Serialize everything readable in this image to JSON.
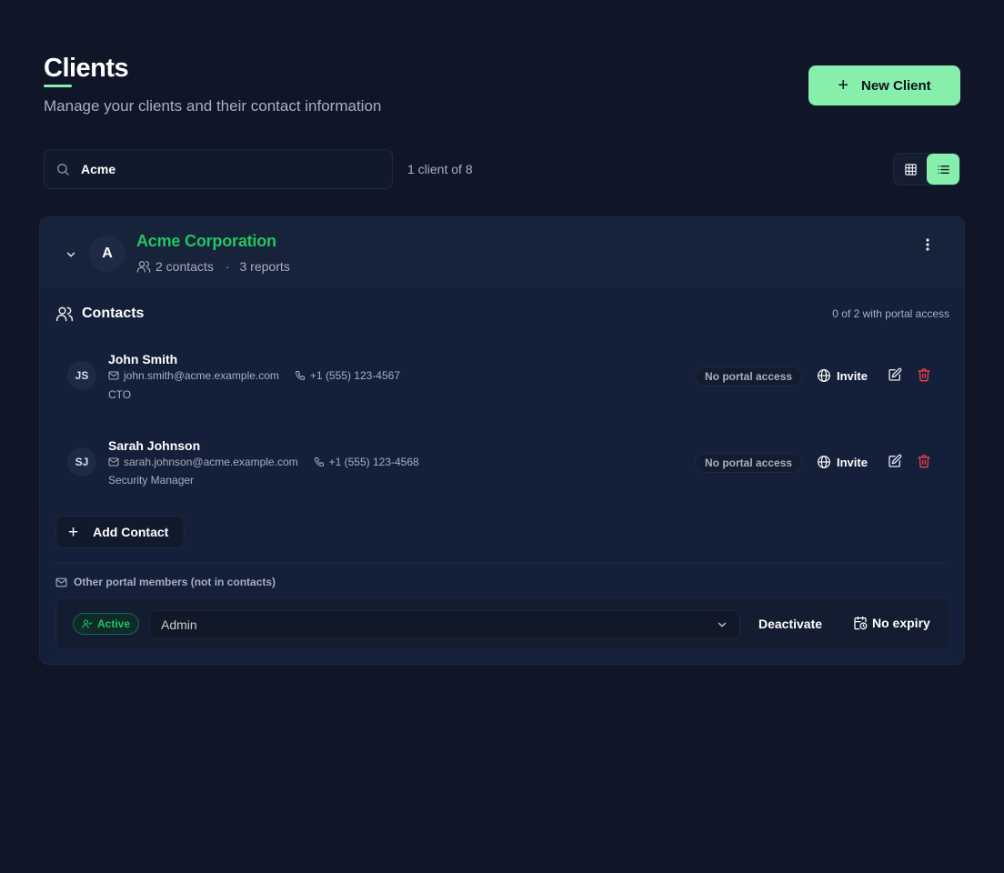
{
  "header": {
    "title": "Clients",
    "subtitle": "Manage your clients and their contact information",
    "new_client_label": "New Client"
  },
  "search": {
    "value": "Acme",
    "result_count": "1 client of 8"
  },
  "view_toggle": {
    "options": [
      "grid",
      "list"
    ],
    "active": "list"
  },
  "client": {
    "avatar_initial": "A",
    "name": "Acme Corporation",
    "contacts_count": "2 contacts",
    "separator": "·",
    "reports_count": "3 reports"
  },
  "contacts_section": {
    "title": "Contacts",
    "portal_summary": "0 of 2 with portal access",
    "items": [
      {
        "initials": "JS",
        "name": "John Smith",
        "email": "john.smith@acme.example.com",
        "phone": "+1 (555) 123-4567",
        "role": "CTO",
        "access": "No portal access",
        "invite_label": "Invite"
      },
      {
        "initials": "SJ",
        "name": "Sarah Johnson",
        "email": "sarah.johnson@acme.example.com",
        "phone": "+1 (555) 123-4568",
        "role": "Security Manager",
        "access": "No portal access",
        "invite_label": "Invite"
      }
    ],
    "add_contact_label": "Add Contact"
  },
  "other_members": {
    "title": "Other portal members (not in contacts)",
    "member": {
      "status": "Active",
      "role_value": "Admin",
      "deactivate_label": "Deactivate",
      "expiry_label": "No expiry"
    }
  },
  "colors": {
    "background": "#101628",
    "accent": "#86efac",
    "client_name": "#22c55e",
    "danger": "#ef4444"
  }
}
